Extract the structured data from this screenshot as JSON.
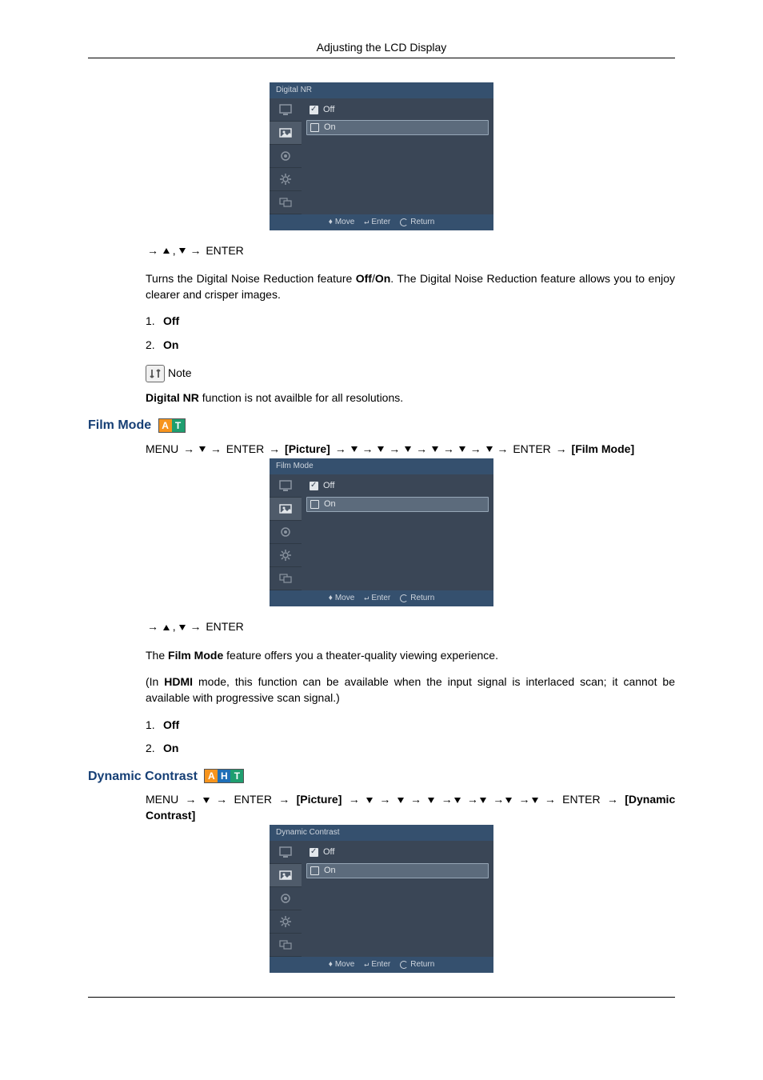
{
  "header": {
    "title": "Adjusting the LCD Display"
  },
  "osd_footer": {
    "move_sym": "♦",
    "move_label": "Move",
    "enter_sym": "↵",
    "enter_label": "Enter",
    "return_label": "Return"
  },
  "digital_nr": {
    "osd_title": "Digital  NR",
    "options": {
      "off": "Off",
      "on": "On"
    },
    "nav_enter": "ENTER",
    "desc_pre": "Turns the Digital Noise Reduction feature ",
    "desc_off": "Off",
    "desc_slash": "/",
    "desc_on": "On",
    "desc_post": ". The Digital Noise Reduction feature allows you to enjoy clearer and crisper images.",
    "list": {
      "num1": "1.",
      "item1": "Off",
      "num2": "2.",
      "item2": "On"
    },
    "note_label": "Note",
    "note_pre": "Digital NR",
    "note_text": " function is not availble for all resolutions."
  },
  "film_mode": {
    "title": "Film Mode",
    "badges": {
      "a": "A",
      "t": "T"
    },
    "path": {
      "menu": "MENU",
      "enter": "ENTER",
      "picture": "Picture",
      "filmmode": "Film Mode"
    },
    "osd_title": "Film Mode",
    "options": {
      "off": "Off",
      "on": "On"
    },
    "nav_enter": "ENTER",
    "desc_pre": "The ",
    "desc_bold": "Film Mode",
    "desc_post": " feature offers you a theater-quality viewing experience.",
    "desc2_pre": "(In ",
    "desc2_bold": "HDMI",
    "desc2_post": " mode, this function can be available when the input signal is interlaced scan; it cannot be available with progressive scan signal.)",
    "list": {
      "num1": "1.",
      "item1": "Off",
      "num2": "2.",
      "item2": "On"
    }
  },
  "dynamic_contrast": {
    "title": "Dynamic Contrast",
    "badges": {
      "a": "A",
      "h": "H",
      "t": "T"
    },
    "path": {
      "menu": "MENU",
      "enter": "ENTER",
      "picture": "Picture",
      "target": "Dynamic Contrast"
    },
    "osd_title": "Dynamic Contrast",
    "options": {
      "off": "Off",
      "on": "On"
    }
  }
}
